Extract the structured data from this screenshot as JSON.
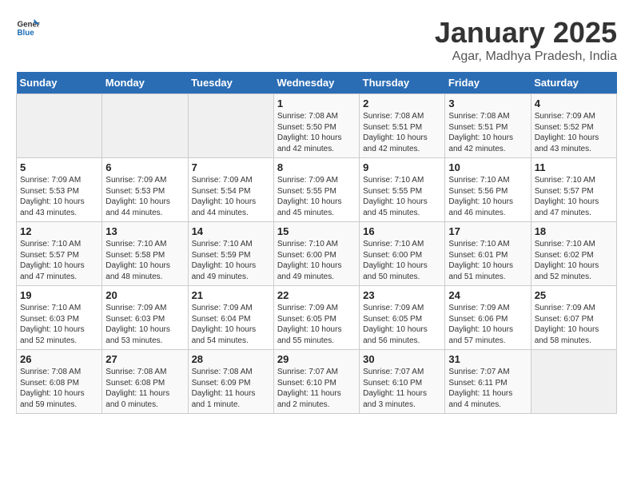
{
  "logo": {
    "general": "General",
    "blue": "Blue"
  },
  "title": "January 2025",
  "subtitle": "Agar, Madhya Pradesh, India",
  "days_of_week": [
    "Sunday",
    "Monday",
    "Tuesday",
    "Wednesday",
    "Thursday",
    "Friday",
    "Saturday"
  ],
  "weeks": [
    [
      {
        "day": "",
        "info": ""
      },
      {
        "day": "",
        "info": ""
      },
      {
        "day": "",
        "info": ""
      },
      {
        "day": "1",
        "info": "Sunrise: 7:08 AM\nSunset: 5:50 PM\nDaylight: 10 hours\nand 42 minutes."
      },
      {
        "day": "2",
        "info": "Sunrise: 7:08 AM\nSunset: 5:51 PM\nDaylight: 10 hours\nand 42 minutes."
      },
      {
        "day": "3",
        "info": "Sunrise: 7:08 AM\nSunset: 5:51 PM\nDaylight: 10 hours\nand 42 minutes."
      },
      {
        "day": "4",
        "info": "Sunrise: 7:09 AM\nSunset: 5:52 PM\nDaylight: 10 hours\nand 43 minutes."
      }
    ],
    [
      {
        "day": "5",
        "info": "Sunrise: 7:09 AM\nSunset: 5:53 PM\nDaylight: 10 hours\nand 43 minutes."
      },
      {
        "day": "6",
        "info": "Sunrise: 7:09 AM\nSunset: 5:53 PM\nDaylight: 10 hours\nand 44 minutes."
      },
      {
        "day": "7",
        "info": "Sunrise: 7:09 AM\nSunset: 5:54 PM\nDaylight: 10 hours\nand 44 minutes."
      },
      {
        "day": "8",
        "info": "Sunrise: 7:09 AM\nSunset: 5:55 PM\nDaylight: 10 hours\nand 45 minutes."
      },
      {
        "day": "9",
        "info": "Sunrise: 7:10 AM\nSunset: 5:55 PM\nDaylight: 10 hours\nand 45 minutes."
      },
      {
        "day": "10",
        "info": "Sunrise: 7:10 AM\nSunset: 5:56 PM\nDaylight: 10 hours\nand 46 minutes."
      },
      {
        "day": "11",
        "info": "Sunrise: 7:10 AM\nSunset: 5:57 PM\nDaylight: 10 hours\nand 47 minutes."
      }
    ],
    [
      {
        "day": "12",
        "info": "Sunrise: 7:10 AM\nSunset: 5:57 PM\nDaylight: 10 hours\nand 47 minutes."
      },
      {
        "day": "13",
        "info": "Sunrise: 7:10 AM\nSunset: 5:58 PM\nDaylight: 10 hours\nand 48 minutes."
      },
      {
        "day": "14",
        "info": "Sunrise: 7:10 AM\nSunset: 5:59 PM\nDaylight: 10 hours\nand 49 minutes."
      },
      {
        "day": "15",
        "info": "Sunrise: 7:10 AM\nSunset: 6:00 PM\nDaylight: 10 hours\nand 49 minutes."
      },
      {
        "day": "16",
        "info": "Sunrise: 7:10 AM\nSunset: 6:00 PM\nDaylight: 10 hours\nand 50 minutes."
      },
      {
        "day": "17",
        "info": "Sunrise: 7:10 AM\nSunset: 6:01 PM\nDaylight: 10 hours\nand 51 minutes."
      },
      {
        "day": "18",
        "info": "Sunrise: 7:10 AM\nSunset: 6:02 PM\nDaylight: 10 hours\nand 52 minutes."
      }
    ],
    [
      {
        "day": "19",
        "info": "Sunrise: 7:10 AM\nSunset: 6:03 PM\nDaylight: 10 hours\nand 52 minutes."
      },
      {
        "day": "20",
        "info": "Sunrise: 7:09 AM\nSunset: 6:03 PM\nDaylight: 10 hours\nand 53 minutes."
      },
      {
        "day": "21",
        "info": "Sunrise: 7:09 AM\nSunset: 6:04 PM\nDaylight: 10 hours\nand 54 minutes."
      },
      {
        "day": "22",
        "info": "Sunrise: 7:09 AM\nSunset: 6:05 PM\nDaylight: 10 hours\nand 55 minutes."
      },
      {
        "day": "23",
        "info": "Sunrise: 7:09 AM\nSunset: 6:05 PM\nDaylight: 10 hours\nand 56 minutes."
      },
      {
        "day": "24",
        "info": "Sunrise: 7:09 AM\nSunset: 6:06 PM\nDaylight: 10 hours\nand 57 minutes."
      },
      {
        "day": "25",
        "info": "Sunrise: 7:09 AM\nSunset: 6:07 PM\nDaylight: 10 hours\nand 58 minutes."
      }
    ],
    [
      {
        "day": "26",
        "info": "Sunrise: 7:08 AM\nSunset: 6:08 PM\nDaylight: 10 hours\nand 59 minutes."
      },
      {
        "day": "27",
        "info": "Sunrise: 7:08 AM\nSunset: 6:08 PM\nDaylight: 11 hours\nand 0 minutes."
      },
      {
        "day": "28",
        "info": "Sunrise: 7:08 AM\nSunset: 6:09 PM\nDaylight: 11 hours\nand 1 minute."
      },
      {
        "day": "29",
        "info": "Sunrise: 7:07 AM\nSunset: 6:10 PM\nDaylight: 11 hours\nand 2 minutes."
      },
      {
        "day": "30",
        "info": "Sunrise: 7:07 AM\nSunset: 6:10 PM\nDaylight: 11 hours\nand 3 minutes."
      },
      {
        "day": "31",
        "info": "Sunrise: 7:07 AM\nSunset: 6:11 PM\nDaylight: 11 hours\nand 4 minutes."
      },
      {
        "day": "",
        "info": ""
      }
    ]
  ]
}
